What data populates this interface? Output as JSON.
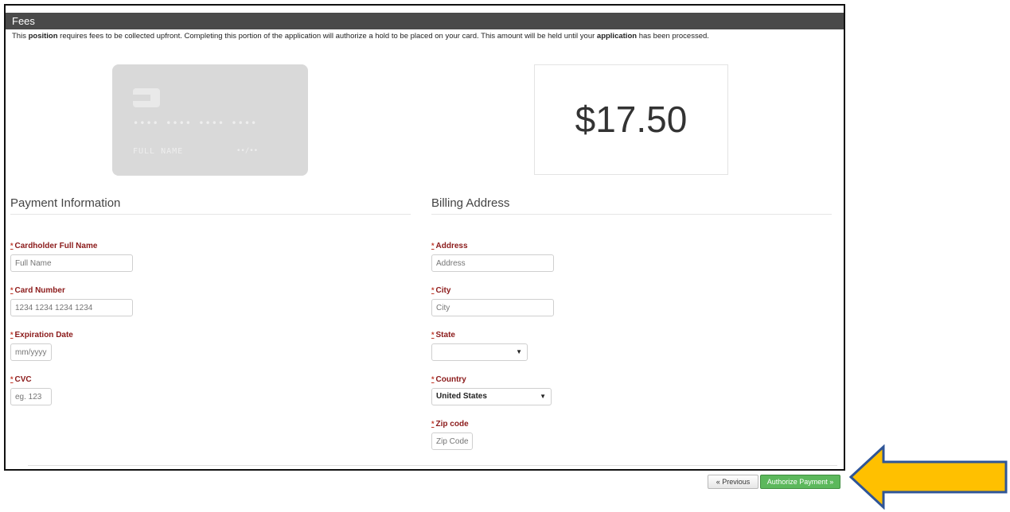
{
  "header": {
    "title": "Fees"
  },
  "intro": {
    "part1": "This ",
    "bold1": "position",
    "part2": " requires fees to be collected upfront. Completing this portion of the application will authorize a hold to be placed on your card. This amount will be held until your ",
    "bold2": "application",
    "part3": " has been processed."
  },
  "card_preview": {
    "number": "•••• •••• •••• ••••",
    "name": "FULL NAME",
    "expiry": "••/••"
  },
  "amount": "$17.50",
  "payment": {
    "title": "Payment Information",
    "fields": {
      "name": {
        "label": "Cardholder Full Name",
        "placeholder": "Full Name"
      },
      "number": {
        "label": "Card Number",
        "placeholder": "1234 1234 1234 1234"
      },
      "expiry": {
        "label": "Expiration Date",
        "placeholder": "mm/yyyy"
      },
      "cvc": {
        "label": "CVC",
        "placeholder": "eg. 123"
      }
    }
  },
  "billing": {
    "title": "Billing Address",
    "fields": {
      "address": {
        "label": "Address",
        "placeholder": "Address"
      },
      "city": {
        "label": "City",
        "placeholder": "City"
      },
      "state": {
        "label": "State",
        "value": ""
      },
      "country": {
        "label": "Country",
        "value": "United States"
      },
      "zip": {
        "label": "Zip code",
        "placeholder": "Zip Code"
      }
    }
  },
  "required_mark": "*",
  "buttons": {
    "previous": "« Previous",
    "authorize": "Authorize Payment »"
  },
  "colors": {
    "header_bg": "#4a4a4a",
    "label": "#8b1a1a",
    "authorize_bg": "#5cb85c",
    "arrow_fill": "#ffc000",
    "arrow_stroke": "#2f5597"
  },
  "icons": {
    "arrow": "left-arrow-icon"
  }
}
